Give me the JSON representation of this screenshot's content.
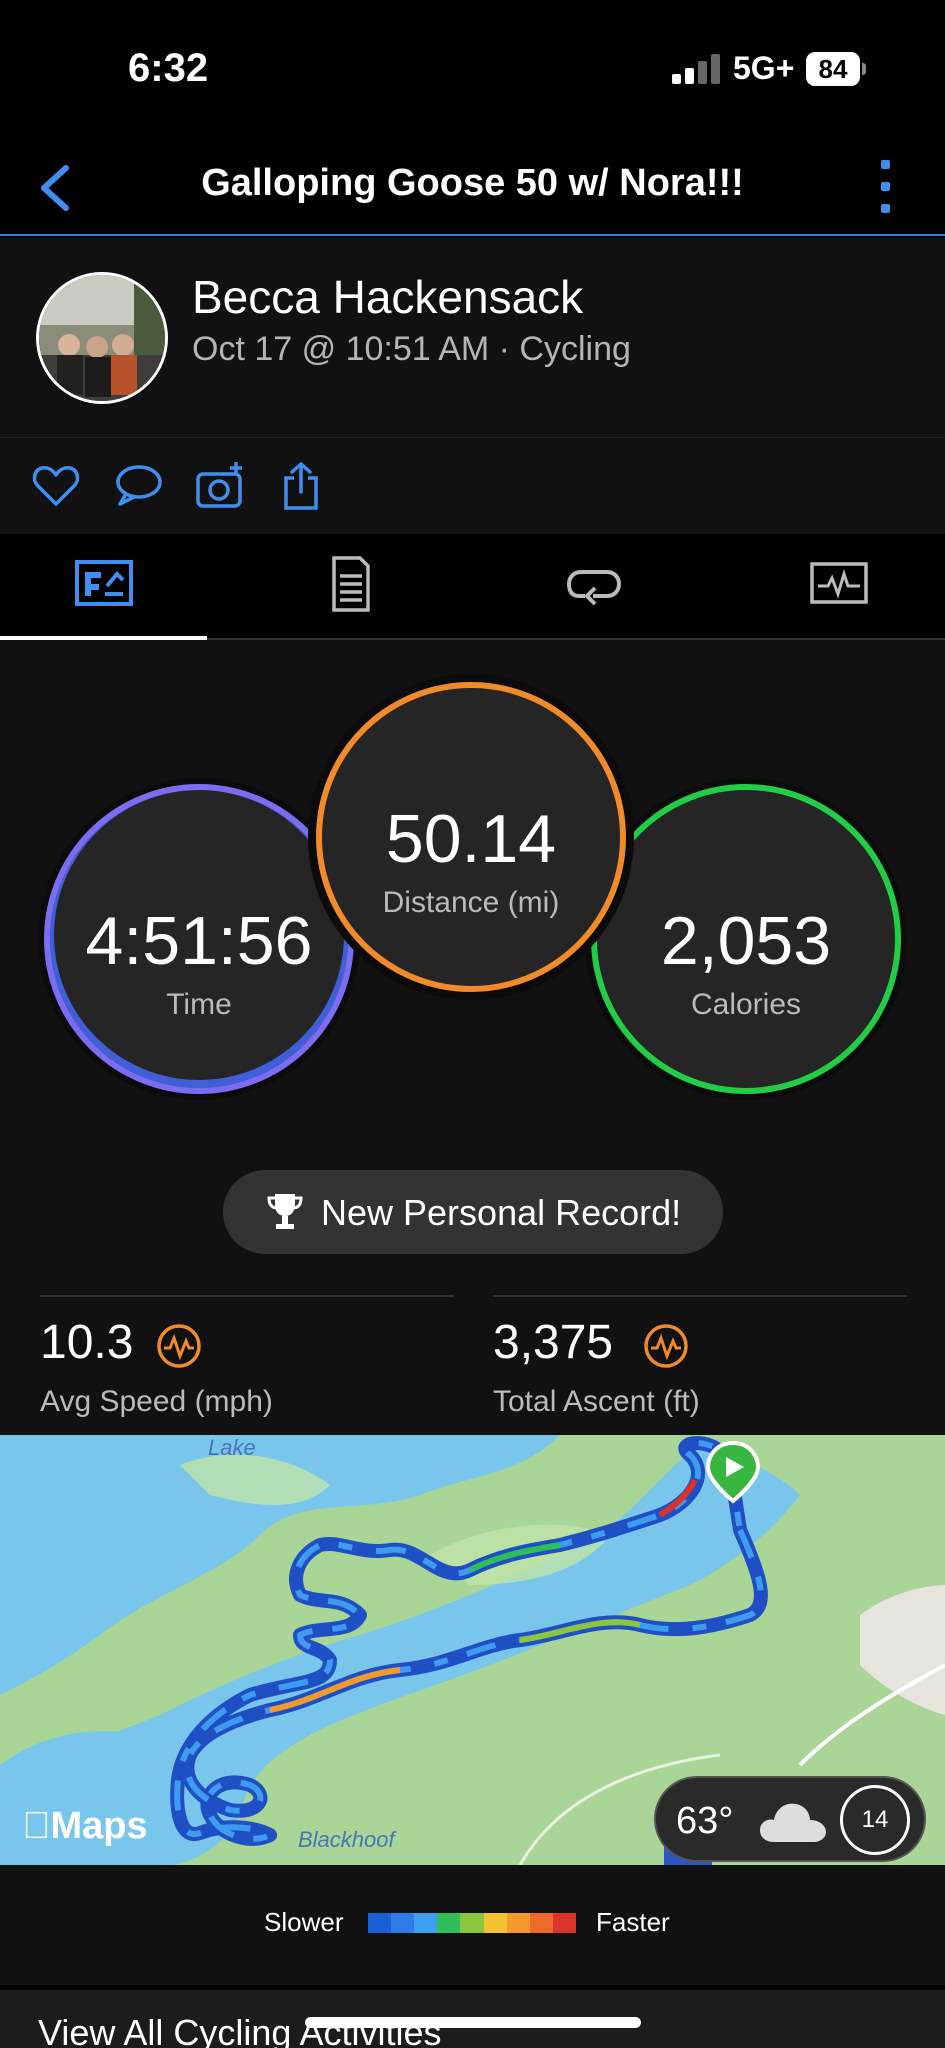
{
  "status": {
    "time": "6:32",
    "network": "5G+",
    "battery": "84"
  },
  "nav": {
    "title": "Galloping Goose 50 w/ Nora!!!",
    "back_icon": "chevron-left-icon",
    "more_icon": "more-vertical-icon"
  },
  "profile": {
    "name": "Becca Hackensack",
    "meta": "Oct 17 @ 10:51 AM · Cycling"
  },
  "actions": [
    "heart-icon",
    "comment-icon",
    "camera-add-icon",
    "share-icon"
  ],
  "tabs": [
    "overview-tab",
    "details-tab",
    "laps-tab",
    "charts-tab"
  ],
  "rings": {
    "time": {
      "value": "4:51:56",
      "label": "Time"
    },
    "distance": {
      "value": "50.14",
      "label": "Distance (mi)"
    },
    "calories": {
      "value": "2,053",
      "label": "Calories"
    }
  },
  "personal_record": {
    "label": "New Personal Record!",
    "icon": "trophy-icon"
  },
  "metrics": {
    "avg_speed": {
      "value": "10.3",
      "label": "Avg Speed (mph)"
    },
    "total_ascent": {
      "value": "3,375",
      "label": "Total Ascent (ft)"
    }
  },
  "map": {
    "provider": "Maps",
    "labels": {
      "lake": "Lake",
      "blackhoof": "Blackhoof"
    },
    "weather": {
      "temp": "63°",
      "wind": "14"
    }
  },
  "legend": {
    "slower": "Slower",
    "faster": "Faster",
    "colors": [
      "#1a5fd6",
      "#2e7ce8",
      "#3fa0f0",
      "#2fbf5a",
      "#8cc63f",
      "#f5c330",
      "#f39a2c",
      "#ee6a2a",
      "#d9332a"
    ]
  },
  "footer": {
    "view_all": "View All Cycling Activities"
  },
  "colors": {
    "accent": "#3f8ff0",
    "time_ring": "#7c6cf2",
    "distance_ring": "#f08a2a",
    "calories_ring": "#22cc44"
  }
}
